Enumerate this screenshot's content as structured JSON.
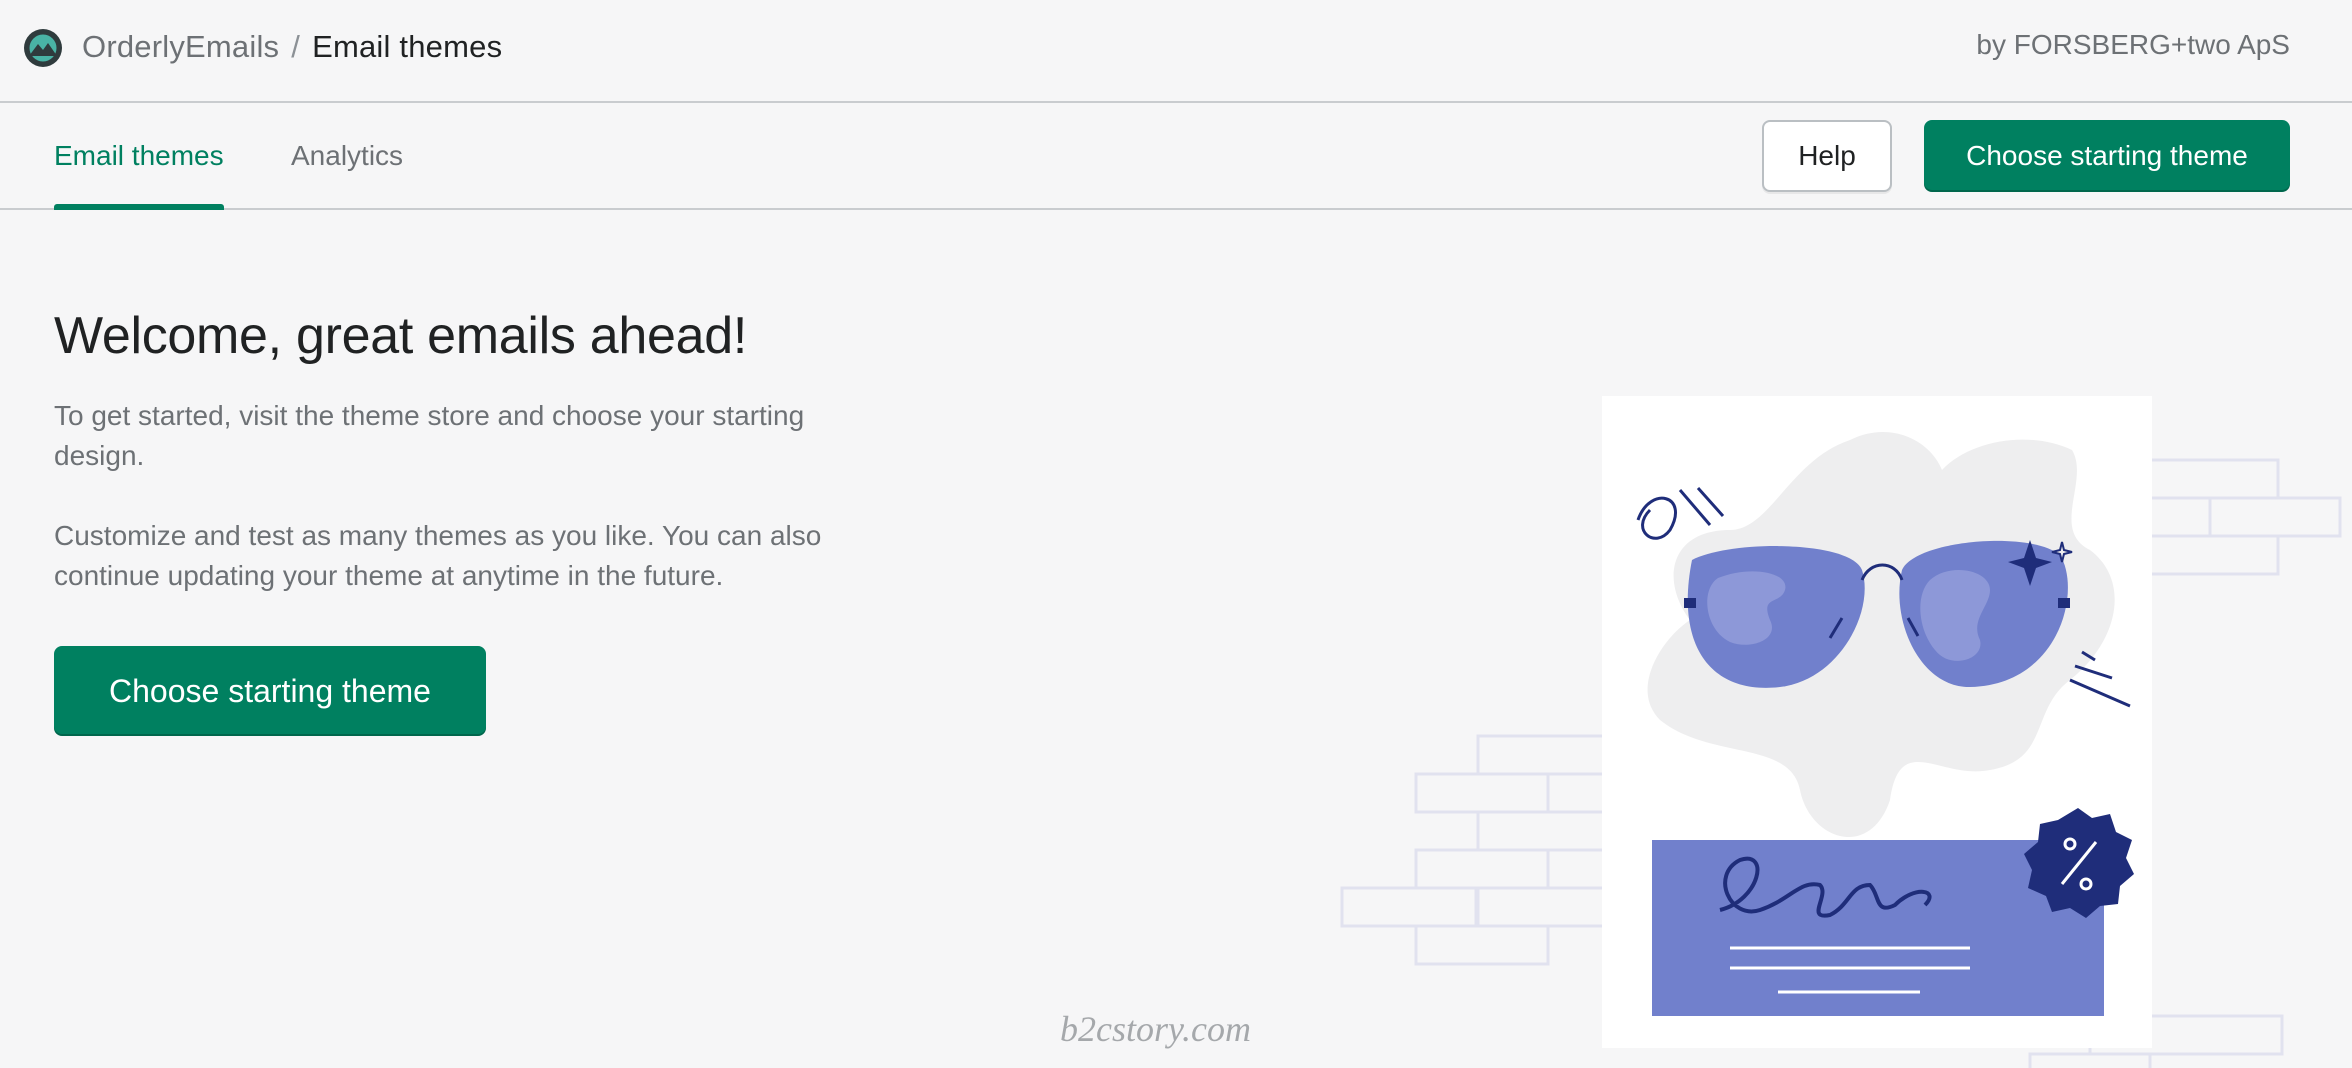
{
  "header": {
    "app_name": "OrderlyEmails",
    "separator": "/",
    "current_page": "Email themes",
    "vendor": "by FORSBERG+two ApS",
    "logo_icon": "orderlyemails-logo-icon"
  },
  "tabs": [
    {
      "label": "Email themes",
      "active": true
    },
    {
      "label": "Analytics",
      "active": false
    }
  ],
  "actions": {
    "help_label": "Help",
    "choose_theme_label": "Choose starting theme"
  },
  "main": {
    "title": "Welcome, great emails ahead!",
    "paragraph_1": "To get started, visit the theme store and choose your starting design.",
    "paragraph_2": "Customize and test as many themes as you like. You can also continue updating your theme at anytime in the future.",
    "cta_label": "Choose starting theme",
    "illustration_icon": "sunglasses-email-illustration"
  },
  "watermark": "b2cstory.com",
  "colors": {
    "accent": "#008060",
    "background": "#f6f6f7",
    "illustration_blue": "#7180cc",
    "illustration_navy": "#1f2d7a"
  }
}
